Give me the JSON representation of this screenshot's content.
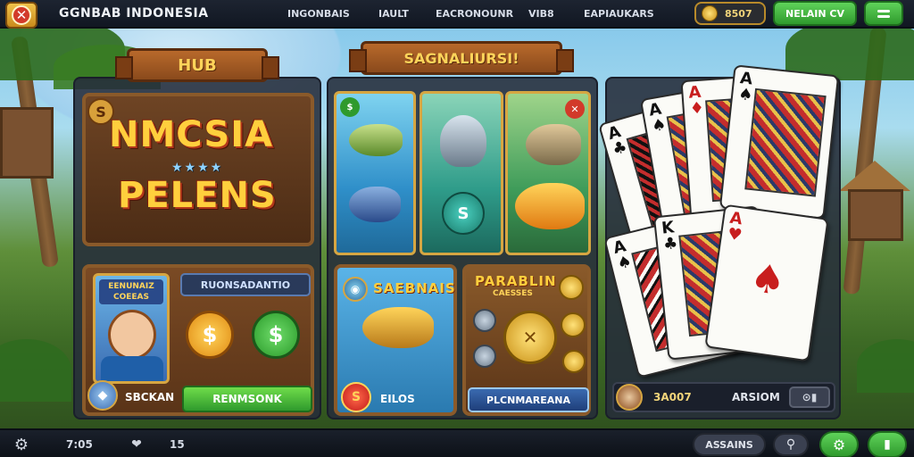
{
  "topbar": {
    "brand": "GGNBAB INDONESIA",
    "nav": [
      "INGONBAIS",
      "IAULT",
      "EACRONOUNR",
      "VIB8",
      "EAPIAUKARS"
    ],
    "coins": "8507",
    "cta_label": "NELAIN CV"
  },
  "hub": {
    "banner": "HUB",
    "title_line1": "NMCSIA",
    "title_line2": "PELENS",
    "profile_title": "EENUNAIZ",
    "profile_subtitle": "COEEAS",
    "name_tag": "RUONSADANTIO",
    "player_label": "SBCKAN",
    "action_button": "RENMSONK"
  },
  "slots": {
    "banner": "SAGNALIURSI!",
    "game1_title": "SAEBNAIS",
    "game1_label": "EILOS",
    "game2_title": "PARABLIN",
    "game2_subtitle": "CAESSES",
    "game2_button": "PLCNMAREANA"
  },
  "cards_panel": {
    "player_value": "3A007",
    "player_name": "ARSIOM"
  },
  "bottombar": {
    "time": "7:05",
    "level": "15",
    "assign_label": "ASSAINS"
  },
  "colors": {
    "accent_green": "#3fb53b",
    "gold": "#f1c24a",
    "banner_brown": "#8a4a1c"
  }
}
